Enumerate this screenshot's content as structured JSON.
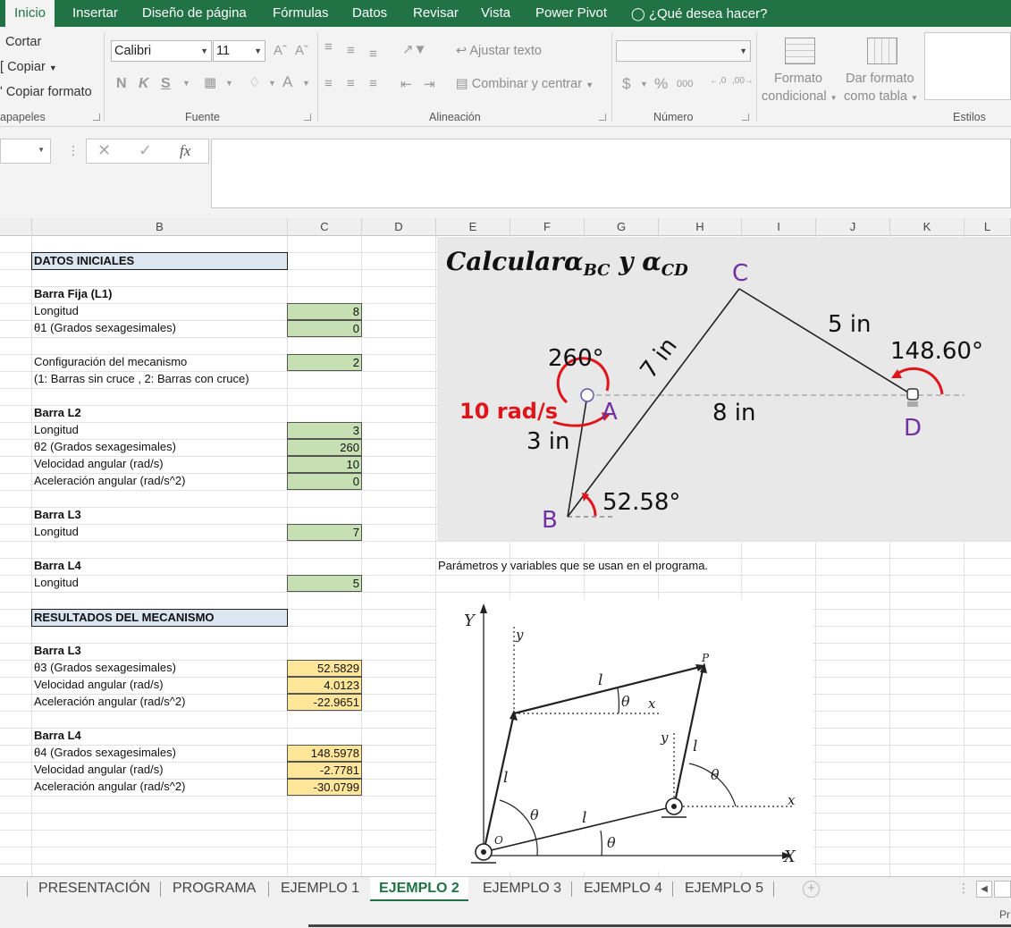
{
  "ribbon_tabs": [
    "Inicio",
    "Insertar",
    "Diseño de página",
    "Fórmulas",
    "Datos",
    "Revisar",
    "Vista",
    "Power Pivot"
  ],
  "tell_me": "¿Qué desea hacer?",
  "clipboard": {
    "cut": "Cortar",
    "copy": "Copiar",
    "format_painter": "Copiar formato",
    "group": "apapeles"
  },
  "font": {
    "name": "Calibri",
    "size": "11",
    "group": "Fuente"
  },
  "alignment": {
    "wrap": "Ajustar texto",
    "merge": "Combinar y centrar",
    "group": "Alineación"
  },
  "number": {
    "group": "Número"
  },
  "styles": {
    "cond_format_1": "Formato",
    "cond_format_2": "condicional",
    "table_format_1": "Dar formato",
    "table_format_2": "como tabla",
    "group": "Estilos"
  },
  "formula_bar": {
    "fx": "fx",
    "content": ""
  },
  "columns": [
    "B",
    "C",
    "D",
    "E",
    "F",
    "G",
    "H",
    "I",
    "J",
    "K",
    "L"
  ],
  "sheet": {
    "datos_iniciales": "DATOS INICIALES",
    "barra_fija": "Barra Fija (L1)",
    "longitud": "Longitud",
    "theta1_label": "θ1 (Grados sexagesimales)",
    "config_label": "Configuración del mecanismo",
    "config_note": "(1: Barras sin cruce , 2: Barras con cruce)",
    "barra_l2": "Barra L2",
    "theta2_label": "θ2 (Grados sexagesimales)",
    "vel_label": "Velocidad angular (rad/s)",
    "acc_label": "Aceleración angular (rad/s^2)",
    "barra_l3": "Barra L3",
    "barra_l4": "Barra L4",
    "resultados": "RESULTADOS DEL MECANISMO",
    "theta3_label": "θ3 (Grados sexagesimales)",
    "theta4_label": "θ4 (Grados sexagesimales)",
    "l1_longitud": "8",
    "theta1": "0",
    "config": "2",
    "l2_longitud": "3",
    "theta2": "260",
    "l2_vel": "10",
    "l2_acc": "0",
    "l3_longitud": "7",
    "l4_longitud": "5",
    "theta3": "52.5829",
    "l3_vel": "4.0123",
    "l3_acc": "-22.9651",
    "theta4": "148.5978",
    "l4_vel": "-2.7781",
    "l4_acc": "-30.0799",
    "param_caption": "Parámetros y variables que se usan en el programa."
  },
  "mechanism": {
    "title_main": "Calcular",
    "title_a": "α",
    "title_a_sub": "BC",
    "title_y": " y ",
    "title_b": "α",
    "title_b_sub": "CD",
    "angle_a": "260°",
    "speed": "10 rad/s",
    "l2": "3 in",
    "l3": "7 in",
    "l4": "5 in",
    "l1": "8 in",
    "angle_d": "148.60°",
    "angle_b": "52.58°",
    "pt_a": "A",
    "pt_b": "B",
    "pt_c": "C",
    "pt_d": "D",
    "colors": {
      "red": "#e0151b",
      "purple": "#7030a0"
    }
  },
  "params_diagram": {
    "Y": "Y",
    "X": "X",
    "y": "y",
    "x": "x",
    "l1": "l",
    "l2": "l",
    "l3": "l",
    "l4": "l",
    "theta1": "θ",
    "theta2": "θ",
    "theta3": "θ",
    "theta4": "θ",
    "o1": "O",
    "p1": "P"
  },
  "sheet_tabs": [
    "PRESENTACIÓN",
    "PROGRAMA",
    "EJEMPLO 1",
    "EJEMPLO 2",
    "EJEMPLO 3",
    "EJEMPLO 4",
    "EJEMPLO 5"
  ],
  "status": "Pr"
}
